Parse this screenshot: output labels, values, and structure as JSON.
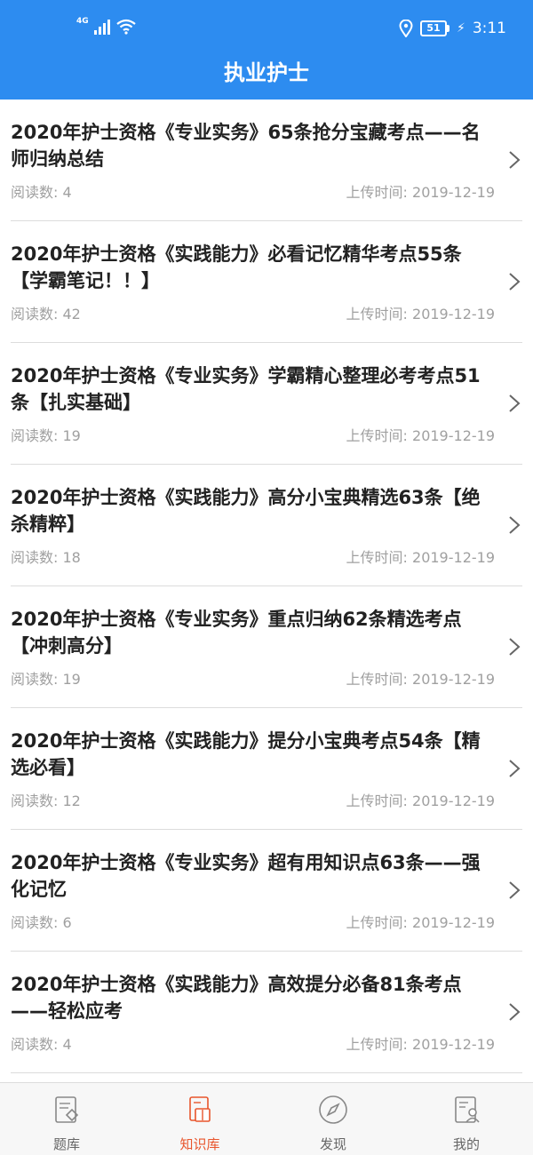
{
  "status_bar": {
    "network": "4G",
    "battery": "51",
    "time": "3:11"
  },
  "header": {
    "title": "执业护士"
  },
  "list": {
    "read_label": "阅读数:",
    "time_label": "上传时间:",
    "items": [
      {
        "title": "2020年护士资格《专业实务》65条抢分宝藏考点——名师归纳总结",
        "reads": "4",
        "date": "2019-12-19"
      },
      {
        "title": "2020年护士资格《实践能力》必看记忆精华考点55条【学霸笔记！！】",
        "reads": "42",
        "date": "2019-12-19"
      },
      {
        "title": "2020年护士资格《专业实务》学霸精心整理必考考点51条【扎实基础】",
        "reads": "19",
        "date": "2019-12-19"
      },
      {
        "title": "2020年护士资格《实践能力》高分小宝典精选63条【绝杀精粹】",
        "reads": "18",
        "date": "2019-12-19"
      },
      {
        "title": "2020年护士资格《专业实务》重点归纳62条精选考点【冲刺高分】",
        "reads": "19",
        "date": "2019-12-19"
      },
      {
        "title": "2020年护士资格《实践能力》提分小宝典考点54条【精选必看】",
        "reads": "12",
        "date": "2019-12-19"
      },
      {
        "title": "2020年护士资格《专业实务》超有用知识点63条——强化记忆",
        "reads": "6",
        "date": "2019-12-19"
      },
      {
        "title": "2020年护士资格《实践能力》高效提分必备81条考点——轻松应考",
        "reads": "4",
        "date": "2019-12-19"
      }
    ]
  },
  "tabbar": {
    "tabs": [
      {
        "label": "题库",
        "icon": "question-bank-icon"
      },
      {
        "label": "知识库",
        "icon": "knowledge-base-icon",
        "active": true
      },
      {
        "label": "发现",
        "icon": "compass-icon"
      },
      {
        "label": "我的",
        "icon": "profile-icon"
      }
    ]
  },
  "colors": {
    "header": "#2d8cf0",
    "active_tab": "#e8552c",
    "meta_text": "#a0a0a0"
  }
}
